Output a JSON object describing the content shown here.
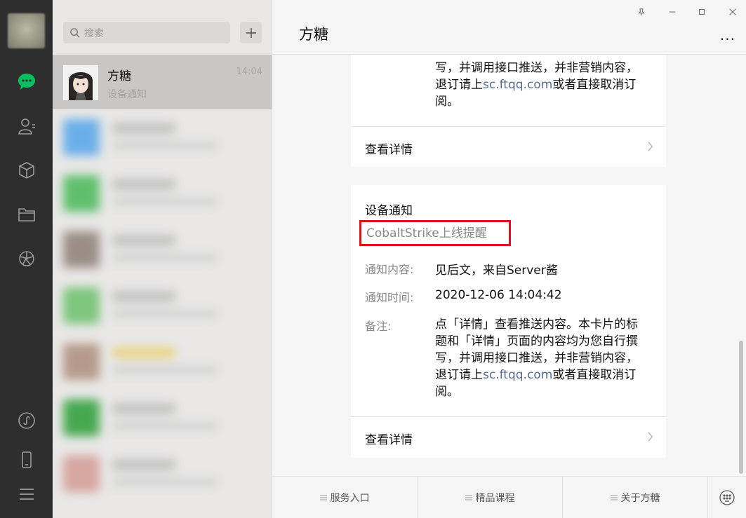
{
  "search": {
    "placeholder": "搜索"
  },
  "active_chat": {
    "name": "方糖",
    "time": "14:04",
    "preview": "设备通知"
  },
  "window": {
    "title": "方糖"
  },
  "card1": {
    "lines": [
      "写，并调用接口推送，并非营销内容，",
      "退订请上",
      "sc.ftqq.com",
      "或者直接取消订",
      "阅。"
    ],
    "detail_label": "查看详情"
  },
  "card2": {
    "title": "设备通知",
    "subtitle": "CobaltStrike上线提醒",
    "content_label": "通知内容:",
    "content_value": "见后文，来自Server酱",
    "time_label": "通知时间:",
    "time_value": "2020-12-06 14:04:42",
    "note_label": "备注:",
    "note_line1": "点「详情」查看推送内容。本卡片的标",
    "note_line2": "题和「详情」页面的内容均为您自行撰",
    "note_line3": "写，并调用接口推送，并非营销内容，",
    "note_line4_pre": "退订请上",
    "note_link": "sc.ftqq.com",
    "note_line4_post": "或者直接取消订",
    "note_line5": "阅。",
    "detail_label": "查看详情"
  },
  "menu": [
    {
      "label": "服务入口"
    },
    {
      "label": "精品课程"
    },
    {
      "label": "关于方糖"
    }
  ],
  "colors": {
    "accent_green": "#07c160",
    "link": "#576b95",
    "highlight_red": "#e0101e"
  }
}
